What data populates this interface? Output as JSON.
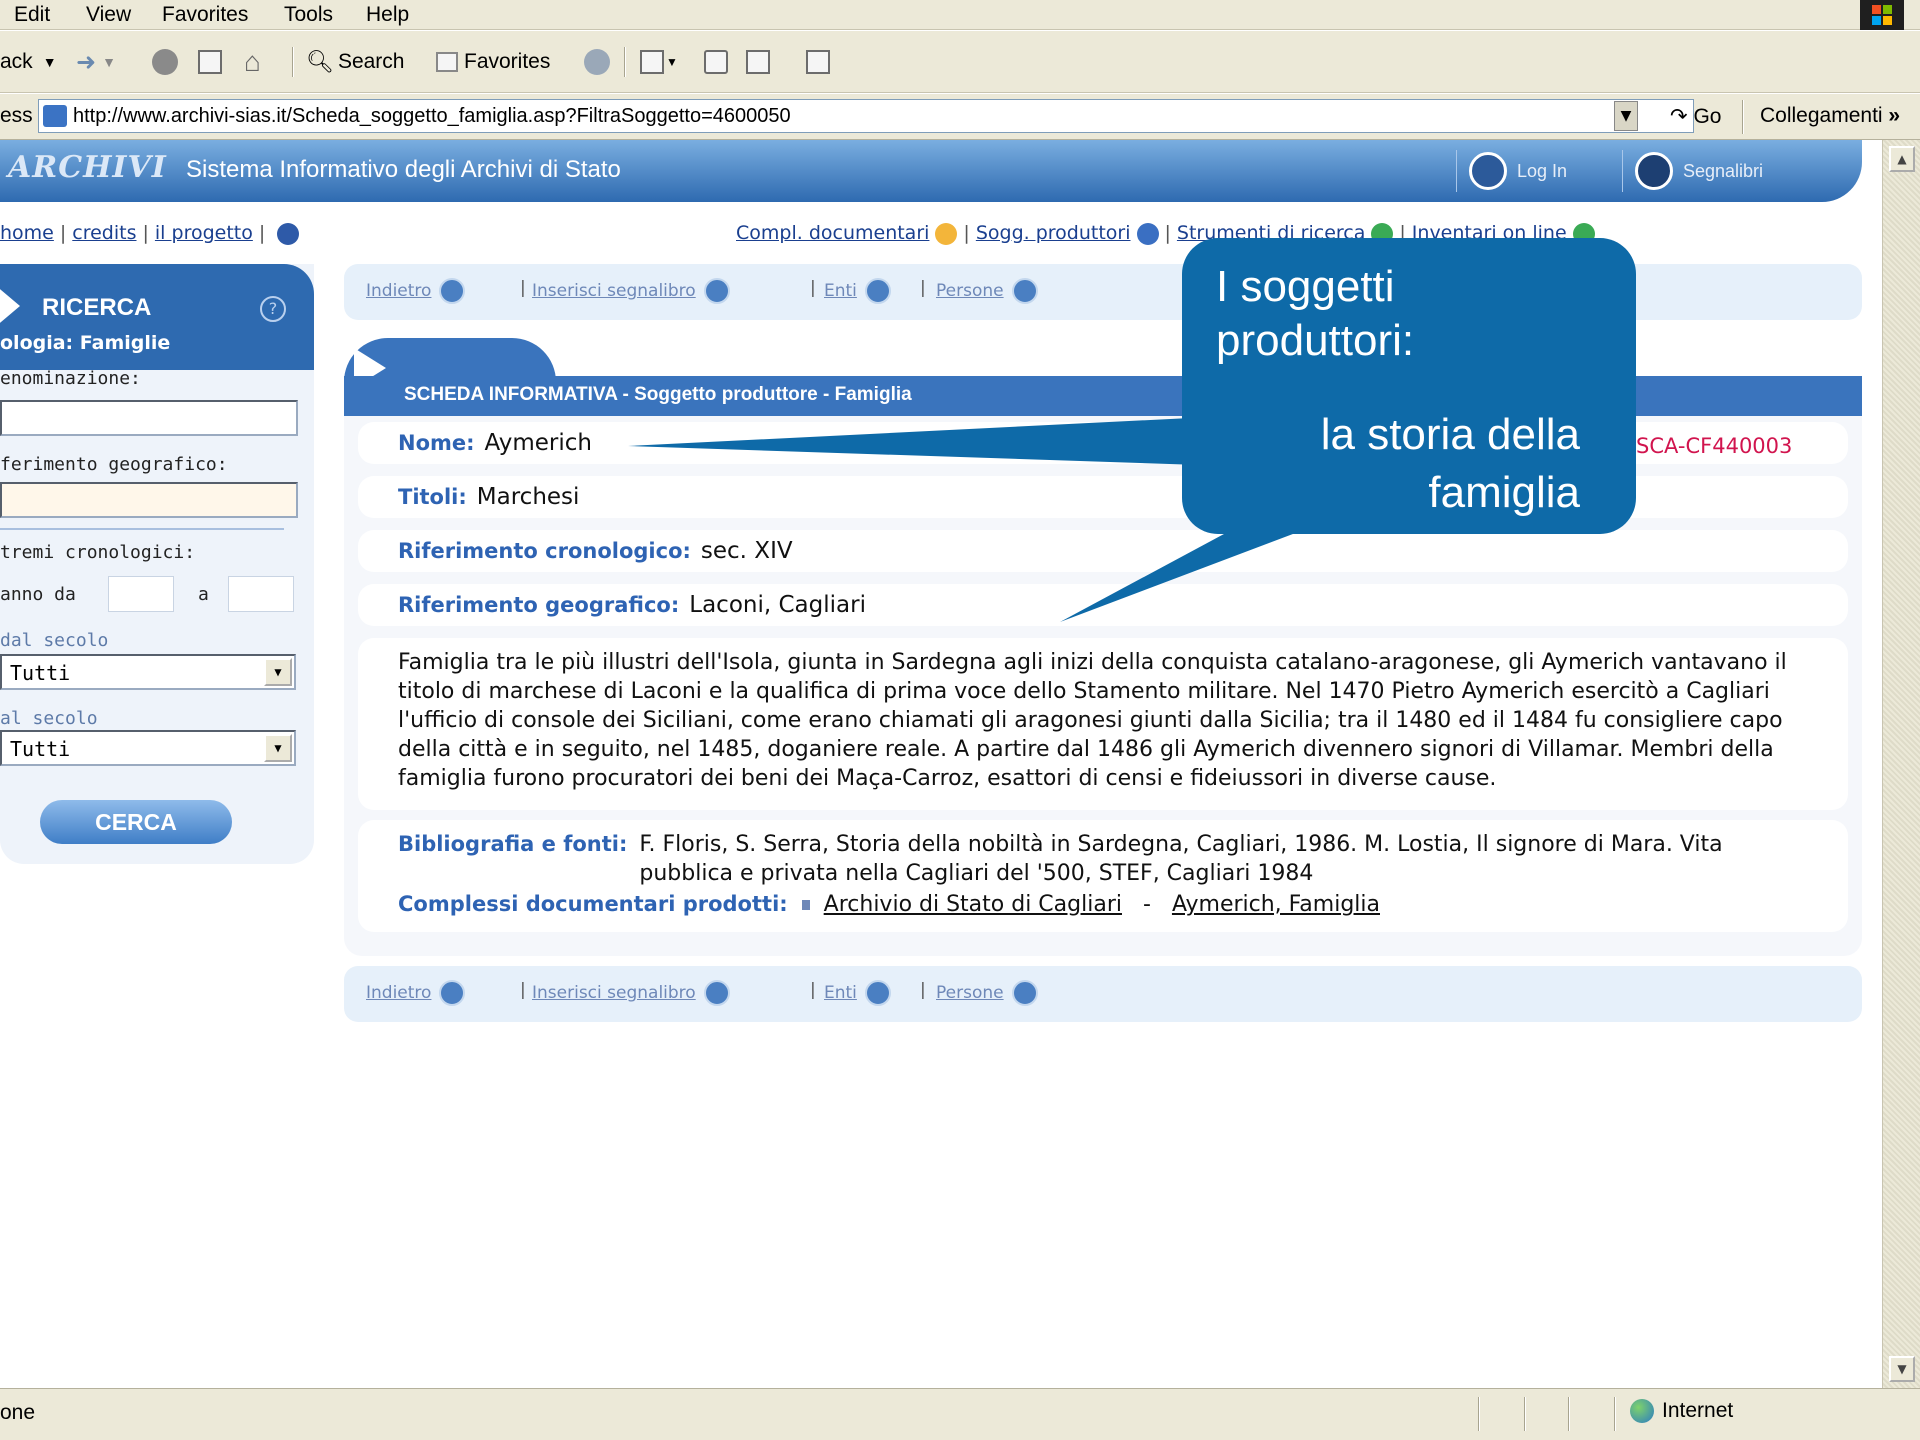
{
  "browser": {
    "menu": [
      "Edit",
      "View",
      "Favorites",
      "Tools",
      "Help"
    ],
    "toolbar": {
      "back": "ack",
      "search": "Search",
      "favorites": "Favorites"
    },
    "address_label": "ess",
    "url": "http://www.archivi-sias.it/Scheda_soggetto_famiglia.asp?FiltraSoggetto=4600050",
    "go": "Go",
    "links": "Collegamenti",
    "links_chevron": "»",
    "status": "one",
    "zone": "Internet"
  },
  "site": {
    "logo": "ARCHIVI",
    "title": "Sistema Informativo degli Archivi di Stato",
    "login": "Log In",
    "bookmarks": "Segnalibri",
    "nav_left": [
      "home",
      "credits",
      "il progetto"
    ],
    "nav_right": [
      "Compl. documentari",
      "Sogg. produttori",
      "Strumenti di ricerca",
      "Inventari on line"
    ]
  },
  "actions": [
    "Indietro",
    "Inserisci segnalibro",
    "Enti",
    "Persone"
  ],
  "sidebar": {
    "title": "RICERCA",
    "tipologia": "ologia: Famiglie",
    "denominazione": "enominazione:",
    "riferimento": "ferimento geografico:",
    "estremi": "tremi cronologici:",
    "anno_da": "anno da",
    "a": "a",
    "dal_secolo": "dal secolo",
    "al_secolo": "al secolo",
    "dal_value": "Tutti",
    "al_value": "Tutti",
    "button": "CERCA"
  },
  "card": {
    "heading": "SCHEDA INFORMATIVA - Soggetto produttore - Famiglia",
    "code": "SCA-CF440003",
    "fields": [
      {
        "label": "Nome:",
        "value": "Aymerich"
      },
      {
        "label": "Titoli:",
        "value": "Marchesi"
      },
      {
        "label": "Riferimento cronologico:",
        "value": "sec. XIV"
      },
      {
        "label": "Riferimento geografico:",
        "value": "Laconi, Cagliari"
      }
    ],
    "description": "Famiglia tra le più illustri dell'Isola, giunta in Sardegna agli inizi della conquista catalano-aragonese, gli Aymerich vantavano il titolo di marchese di Laconi e la qualifica di prima voce dello Stamento militare. Nel 1470 Pietro Aymerich esercitò a Cagliari l'ufficio di console dei Siciliani, come erano chiamati gli aragonesi giunti dalla Sicilia; tra il 1480 ed il 1484 fu consigliere capo della città e in seguito, nel 1485, doganiere reale. A partire dal 1486 gli Aymerich divennero signori di Villamar. Membri della famiglia furono procuratori dei beni dei Maça-Carroz, esattori di censi e fideiussori in diverse cause.",
    "bibliography_label": "Bibliografia e fonti:",
    "bibliography": "F. Floris, S. Serra, Storia della nobiltà in Sardegna, Cagliari, 1986. M. Lostia, Il signore di Mara. Vita pubblica e privata nella Cagliari del '500, STEF, Cagliari 1984",
    "complessi_label": "Complessi documentari prodotti:",
    "complessi_link1": "Archivio di Stato di Cagliari",
    "complessi_dash": "-",
    "complessi_link2": "Aymerich, Famiglia"
  },
  "callout": {
    "line1": "I soggetti produttori:",
    "line2": "la storia della famiglia",
    "color": "#0e6aa8"
  }
}
